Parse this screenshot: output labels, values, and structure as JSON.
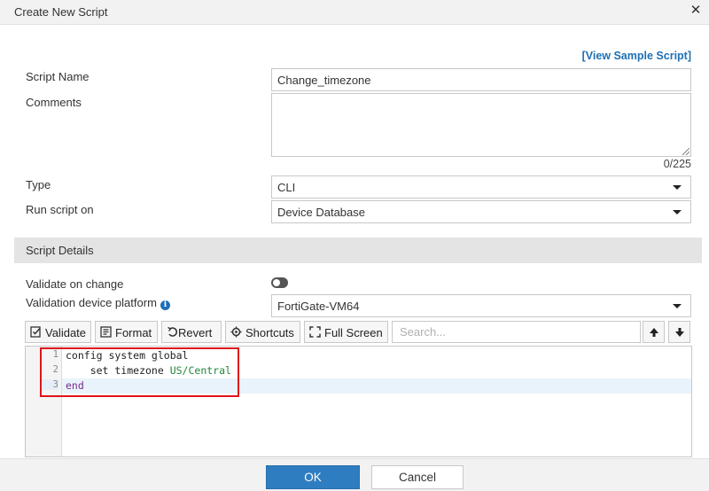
{
  "dialog": {
    "title": "Create New Script",
    "close_icon": "close-icon"
  },
  "form": {
    "view_sample_link": "[View Sample Script]",
    "script_name_label": "Script Name",
    "script_name_value": "Change_timezone",
    "comments_label": "Comments",
    "comments_value": "",
    "comments_counter": "0/225",
    "type_label": "Type",
    "type_value": "CLI",
    "run_on_label": "Run script on",
    "run_on_value": "Device Database"
  },
  "details": {
    "section_title": "Script Details",
    "validate_on_change_label": "Validate on change",
    "validate_on_change_enabled": false,
    "validation_platform_label": "Validation device platform",
    "validation_platform_value": "FortiGate-VM64"
  },
  "toolbar": {
    "validate": "Validate",
    "format": "Format",
    "revert": "Revert",
    "shortcuts": "Shortcuts",
    "full_screen": "Full Screen",
    "search_placeholder": "Search...",
    "icons": [
      "validate-icon",
      "format-icon",
      "revert-icon",
      "shortcuts-icon",
      "fullscreen-icon",
      "arrow-up-icon",
      "arrow-down-icon"
    ]
  },
  "editor": {
    "line_numbers": [
      "1",
      "2",
      "3"
    ],
    "lines": [
      {
        "kw": "",
        "text": "config system global",
        "tail": ""
      },
      {
        "kw": "",
        "text": "    set timezone ",
        "tail": "US/Central"
      },
      {
        "kw": "end",
        "text": "",
        "tail": ""
      }
    ],
    "active_line": 3
  },
  "footer": {
    "ok": "OK",
    "cancel": "Cancel"
  },
  "colors": {
    "accent": "#2f7dc1",
    "link": "#1f6fb5",
    "highlight_box": "#e0141b",
    "keyword": "#7a2b8c",
    "string": "#22863a"
  }
}
